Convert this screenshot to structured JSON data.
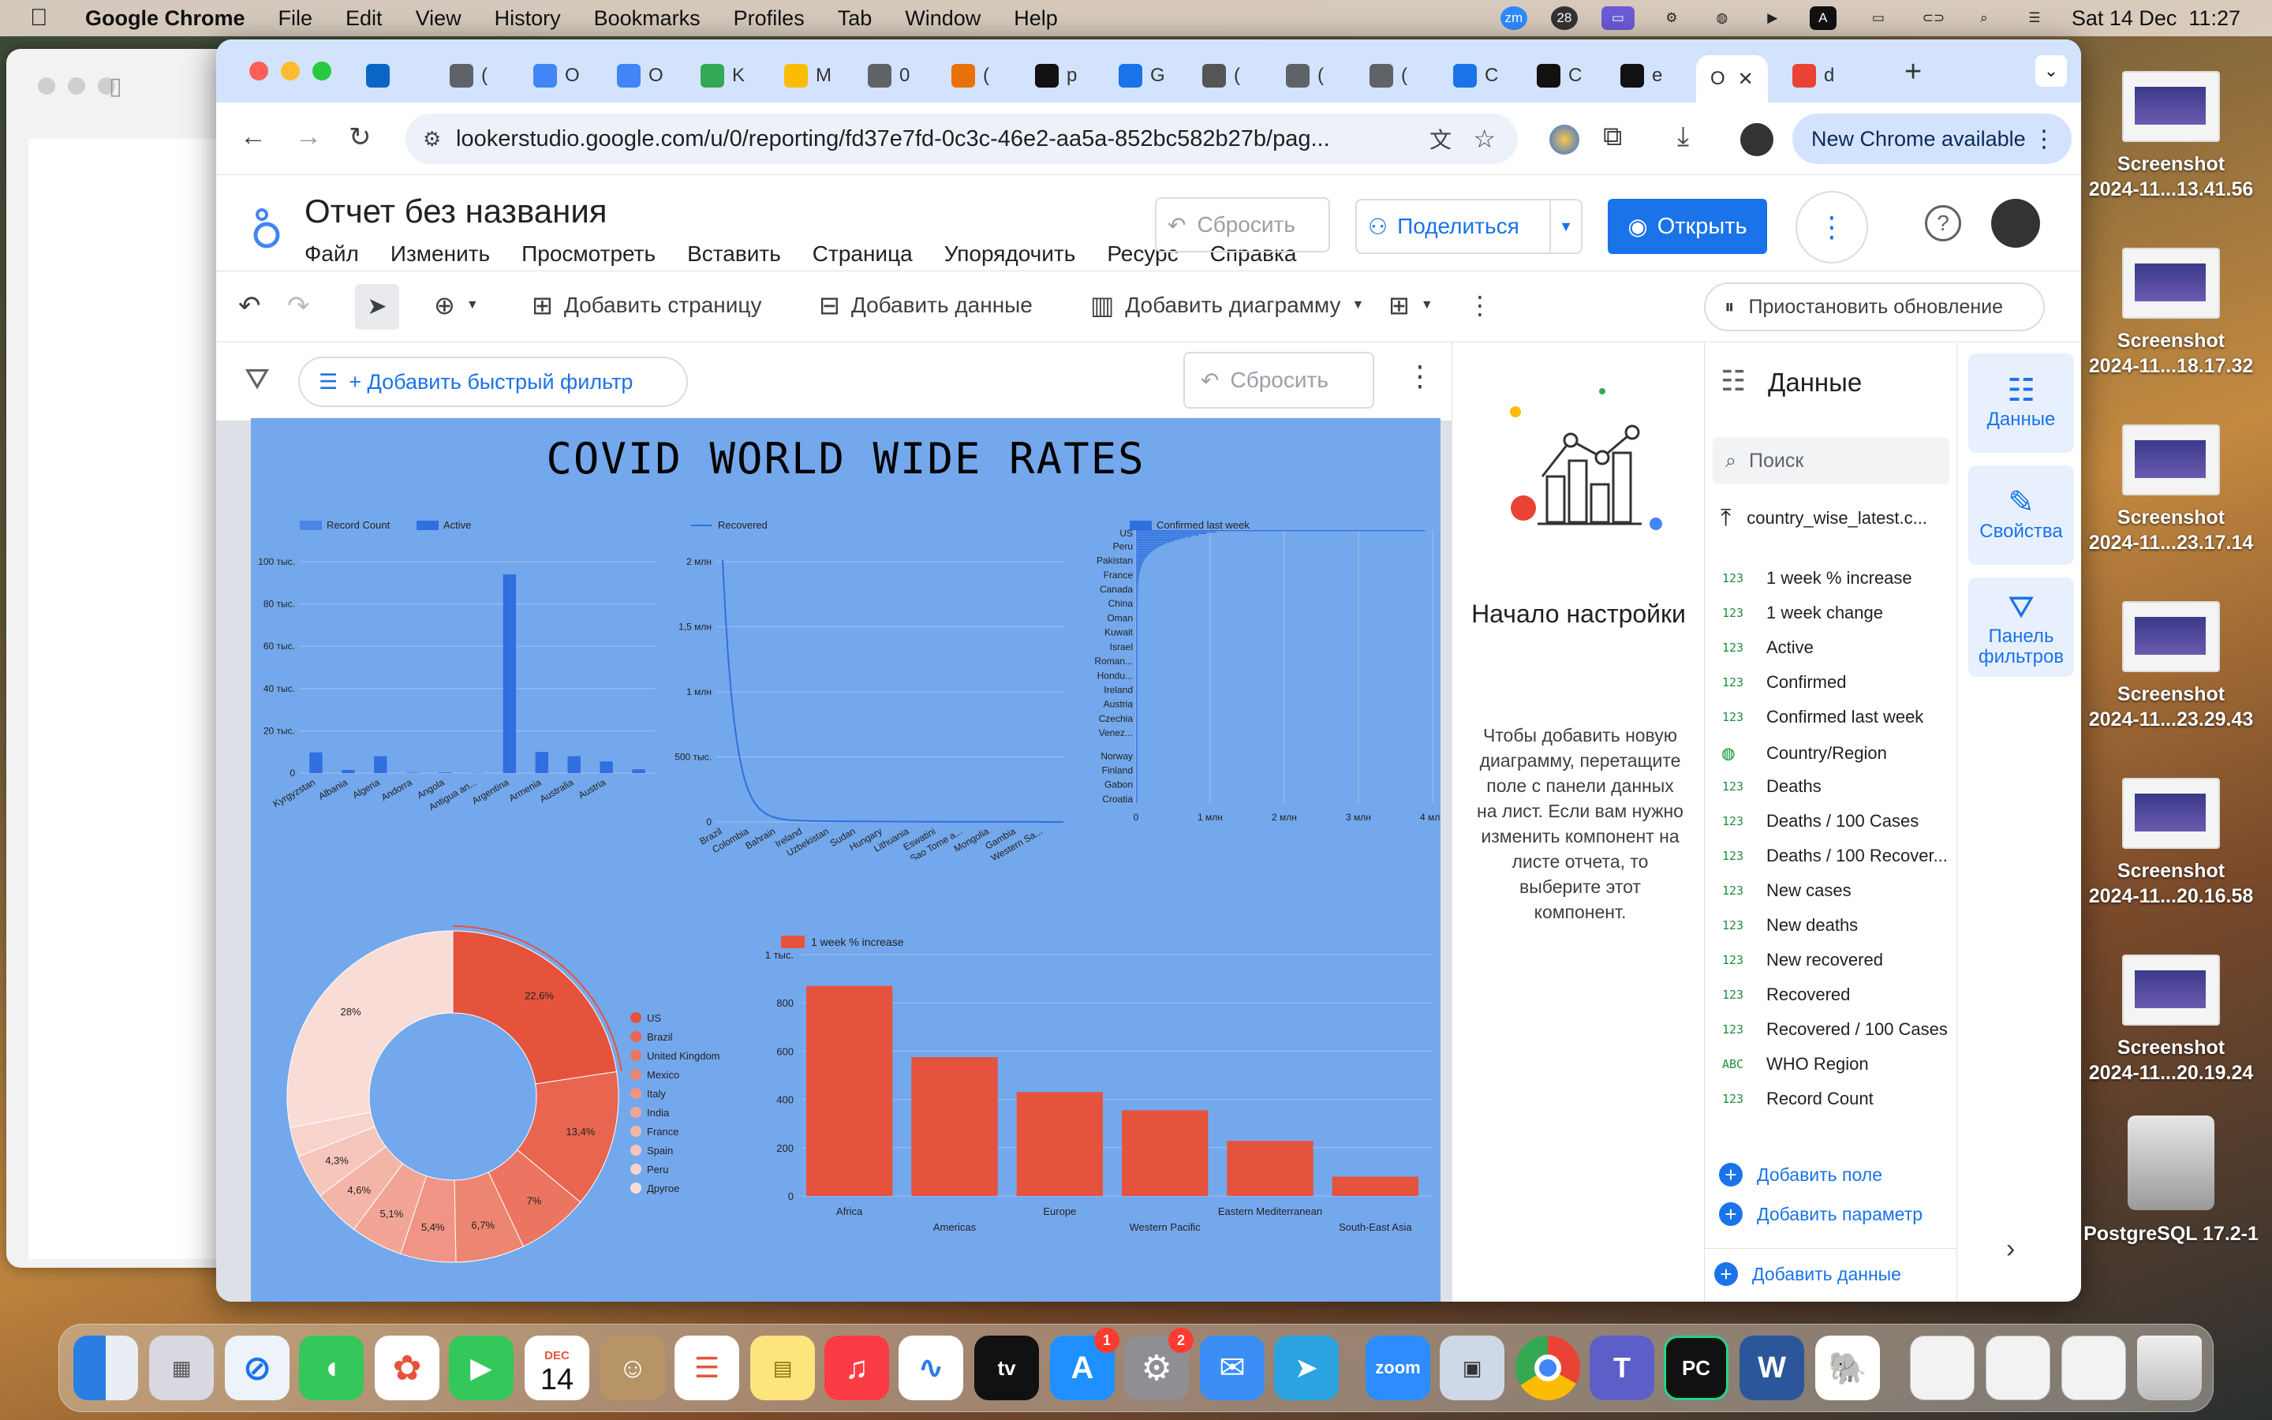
{
  "menubar": {
    "app": "Google Chrome",
    "items": [
      "File",
      "Edit",
      "View",
      "History",
      "Bookmarks",
      "Profiles",
      "Tab",
      "Window",
      "Help"
    ],
    "badge_count": "28",
    "clock": "Sat 14 Dec  11:27"
  },
  "chrome": {
    "tabs": [
      {
        "icon": "linkedin-icon",
        "label": "",
        "color": "#0a66c2"
      },
      {
        "icon": "people-icon",
        "label": "(",
        "color": "#5f6368"
      },
      {
        "icon": "looker-icon",
        "label": "O",
        "color": "#4285f4"
      },
      {
        "icon": "looker-icon",
        "label": "O",
        "color": "#4285f4"
      },
      {
        "icon": "plus-square-icon",
        "label": "K",
        "color": "#34a853"
      },
      {
        "icon": "drive-icon",
        "label": "M",
        "color": "#fbbc04"
      },
      {
        "icon": "globe-icon",
        "label": "0",
        "color": "#5f6368"
      },
      {
        "icon": "mask-icon",
        "label": "(",
        "color": "#e8710a"
      },
      {
        "icon": "github-icon",
        "label": "p",
        "color": "#111"
      },
      {
        "icon": "calendar-icon",
        "label": "G",
        "color": "#1a73e8"
      },
      {
        "icon": "shark-icon",
        "label": "(",
        "color": "#555"
      },
      {
        "icon": "people-icon",
        "label": "(",
        "color": "#5f6368"
      },
      {
        "icon": "user-circle-icon",
        "label": "(",
        "color": "#5f6368"
      },
      {
        "icon": "k-icon",
        "label": "C",
        "color": "#1a73e8"
      },
      {
        "icon": "openai-icon",
        "label": "C",
        "color": "#111"
      },
      {
        "icon": "github-icon",
        "label": "e",
        "color": "#111"
      },
      {
        "icon": "",
        "label": "O",
        "color": "#fff"
      },
      {
        "icon": "google-icon",
        "label": "d",
        "color": "#ea4335"
      }
    ],
    "url": "lookerstudio.google.com/u/0/reporting/fd37e7fd-0c3c-46e2-aa5a-852bc582b27b/pag...",
    "new_chrome": "New Chrome available"
  },
  "looker": {
    "title": "Отчет без названия",
    "menu": [
      "Файл",
      "Изменить",
      "Просмотреть",
      "Вставить",
      "Страница",
      "Упорядочить",
      "Ресурс",
      "Справка"
    ],
    "reset": "Сбросить",
    "share": "Поделиться",
    "open": "Открыть",
    "toolbar": {
      "add_page": "Добавить страницу",
      "add_data": "Добавить данные",
      "add_chart": "Добавить диаграмму",
      "pause": "Приостановить обновление"
    },
    "filterbar": {
      "add_filter": "+ Добавить быстрый фильтр",
      "reset": "Сбросить"
    },
    "report_title": "COVID WORLD WIDE RATES"
  },
  "setup": {
    "heading": "Начало настройки",
    "body": "Чтобы добавить новую диаграмму, перетащите поле с панели данных на лист. Если вам нужно изменить компонент на листе отчета, то выберите этот компонент."
  },
  "data_panel": {
    "title": "Данные",
    "search_placeholder": "Поиск",
    "source": "country_wise_latest.c...",
    "fields": [
      {
        "type": "123",
        "name": "1 week % increase"
      },
      {
        "type": "123",
        "name": "1 week change"
      },
      {
        "type": "123",
        "name": "Active"
      },
      {
        "type": "123",
        "name": "Confirmed"
      },
      {
        "type": "123",
        "name": "Confirmed last week"
      },
      {
        "type": "geo",
        "name": "Country/Region"
      },
      {
        "type": "123",
        "name": "Deaths"
      },
      {
        "type": "123",
        "name": "Deaths / 100 Cases"
      },
      {
        "type": "123",
        "name": "Deaths / 100 Recover..."
      },
      {
        "type": "123",
        "name": "New cases"
      },
      {
        "type": "123",
        "name": "New deaths"
      },
      {
        "type": "123",
        "name": "New recovered"
      },
      {
        "type": "123",
        "name": "Recovered"
      },
      {
        "type": "123",
        "name": "Recovered / 100 Cases"
      },
      {
        "type": "ABC",
        "name": "WHO Region"
      },
      {
        "type": "123",
        "name": "Record Count"
      }
    ],
    "add_field": "Добавить поле",
    "add_param": "Добавить параметр",
    "add_data": "Добавить данные"
  },
  "rail": {
    "data": "Данные",
    "props": "Свойства",
    "filters": "Панель фильтров"
  },
  "desktop": [
    {
      "line1": "Screenshot",
      "line2": "2024-11...13.41.56"
    },
    {
      "line1": "Screenshot",
      "line2": "2024-11...18.17.32"
    },
    {
      "line1": "Screenshot",
      "line2": "2024-11...23.17.14"
    },
    {
      "line1": "Screenshot",
      "line2": "2024-11...23.29.43"
    },
    {
      "line1": "Screenshot",
      "line2": "2024-11...20.16.58"
    },
    {
      "line1": "Screenshot",
      "line2": "2024-11...20.19.24"
    }
  ],
  "disk": "PostgreSQL 17.2-1",
  "dock": {
    "calendar_month": "DEC",
    "calendar_day": "14",
    "appstore_badge": "1",
    "settings_badge": "2",
    "zoom": "zoom"
  },
  "chart_data": [
    {
      "type": "bar",
      "series": [
        {
          "name": "Record Count",
          "color": "#4a86e8"
        },
        {
          "name": "Active",
          "values": [
            9800,
            1500,
            8000,
            200,
            300,
            100,
            94000,
            10000,
            8000,
            5500,
            1800
          ],
          "color": "#2f6fe0"
        }
      ],
      "categories": [
        "Kyrgyzstan",
        "Albania",
        "Algeria",
        "Andorra",
        "Angola",
        "Antigua an...",
        "Argentina",
        "Armenia",
        "Australia",
        "Austria",
        ""
      ],
      "ytick_labels": [
        "0",
        "20 тыс.",
        "40 тыс.",
        "60 тыс.",
        "80 тыс.",
        "100 тыс."
      ],
      "ylim": [
        0,
        100000
      ]
    },
    {
      "type": "line",
      "series": [
        {
          "name": "Recovered",
          "color": "#2f6fe0"
        }
      ],
      "categories": [
        "Brazil",
        "Colombia",
        "Bahrain",
        "Ireland",
        "Uzbekistan",
        "Sudan",
        "Hungary",
        "Lithuania",
        "Eswatini",
        "Sao Tome a...",
        "Mongolia",
        "Gambia",
        "Western Sa..."
      ],
      "ytick_labels": [
        "0",
        "500 тыс.",
        "1 млн",
        "1,5 млн",
        "2 млн"
      ],
      "ylim": [
        0,
        2000000
      ]
    },
    {
      "type": "bar",
      "orientation": "horizontal",
      "series": [
        {
          "name": "Confirmed last week",
          "color": "#2f6fe0"
        }
      ],
      "categories": [
        "US",
        "Peru",
        "Pakistan",
        "France",
        "Canada",
        "China",
        "Oman",
        "Kuwait",
        "Israel",
        "Roman...",
        "Hondu...",
        "Ireland",
        "Austria",
        "Czechia",
        "Venez...",
        "Norway",
        "Finland",
        "Gabon",
        "Croatia"
      ],
      "xtick_labels": [
        "0",
        "1 млн",
        "2 млн",
        "3 млн",
        "4 млн"
      ],
      "xlim": [
        0,
        4000000
      ]
    },
    {
      "type": "pie",
      "donut": true,
      "labels": [
        "US",
        "Brazil",
        "United Kingdom",
        "Mexico",
        "Italy",
        "India",
        "France",
        "Spain",
        "Peru",
        "Другое"
      ],
      "values": [
        22.6,
        13.4,
        7.0,
        6.7,
        5.4,
        5.1,
        4.6,
        4.3,
        2.9,
        28.0
      ],
      "slice_labels": [
        "22,6%",
        "13,4%",
        "7%",
        "6,7%",
        "5,4%",
        "5,1%",
        "4,6%",
        "4,3%",
        "",
        "28%"
      ],
      "colors": [
        "#e5533d",
        "#e8654f",
        "#eb7561",
        "#ed8573",
        "#f09585",
        "#f2a597",
        "#f4b5a9",
        "#f6c5bb",
        "#f8d3cb",
        "#f9dcd6"
      ]
    },
    {
      "type": "bar",
      "series": [
        {
          "name": "1 week % increase",
          "values": [
            870,
            575,
            430,
            355,
            228,
            80
          ],
          "color": "#e5533d"
        }
      ],
      "categories": [
        "Africa",
        "Americas",
        "Europe",
        "Western Pacific",
        "Eastern Mediterranean",
        "South-East Asia"
      ],
      "ytick_labels": [
        "0",
        "200",
        "400",
        "600",
        "800",
        "1 тыс."
      ],
      "ylim": [
        0,
        1000
      ]
    }
  ]
}
